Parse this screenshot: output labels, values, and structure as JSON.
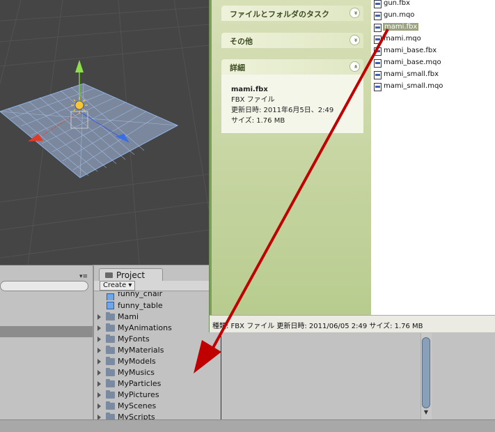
{
  "project_panel": {
    "tab_label": "Project",
    "create_label": "Create",
    "create_caret": "▾",
    "items": [
      {
        "label": "funny_chair",
        "kind": "asset",
        "has_arrow": false
      },
      {
        "label": "funny_table",
        "kind": "asset",
        "has_arrow": false
      },
      {
        "label": "Mami",
        "kind": "folder",
        "has_arrow": true
      },
      {
        "label": "MyAnimations",
        "kind": "folder",
        "has_arrow": true
      },
      {
        "label": "MyFonts",
        "kind": "folder",
        "has_arrow": true
      },
      {
        "label": "MyMaterials",
        "kind": "folder",
        "has_arrow": true
      },
      {
        "label": "MyModels",
        "kind": "folder",
        "has_arrow": true
      },
      {
        "label": "MyMusics",
        "kind": "folder",
        "has_arrow": true
      },
      {
        "label": "MyParticles",
        "kind": "folder",
        "has_arrow": true
      },
      {
        "label": "MyPictures",
        "kind": "folder",
        "has_arrow": true
      },
      {
        "label": "MyScenes",
        "kind": "folder",
        "has_arrow": true
      },
      {
        "label": "MyScripts",
        "kind": "folder",
        "has_arrow": true
      }
    ]
  },
  "hierarchy_panel": {
    "menu_glyph": "▾≡"
  },
  "explorer": {
    "tasks_header": "ファイルとフォルダのタスク",
    "other_header": "その他",
    "details_header": "詳細",
    "chevron_down": "»",
    "chevron_up": "«",
    "details": {
      "file_name": "mami.fbx",
      "file_type": "FBX ファイル",
      "modified": "更新日時: 2011年6月5日、2:49",
      "size": "サイズ: 1.76 MB"
    },
    "files": [
      {
        "name": "gun.fbx",
        "selected": false
      },
      {
        "name": "gun.mqo",
        "selected": false
      },
      {
        "name": "mami.fbx",
        "selected": true
      },
      {
        "name": "mami.mqo",
        "selected": false
      },
      {
        "name": "mami_base.fbx",
        "selected": false
      },
      {
        "name": "mami_base.mqo",
        "selected": false
      },
      {
        "name": "mami_small.fbx",
        "selected": false
      },
      {
        "name": "mami_small.mqo",
        "selected": false
      }
    ],
    "status_bar": "種類: FBX ファイル 更新日時: 2011/06/05 2:49 サイズ: 1.76 MB"
  },
  "scrollbar": {
    "down_glyph": "▼"
  },
  "colors": {
    "annotation_arrow": "#c00000",
    "scene_background": "#454545",
    "explorer_task_pane": "#c5d6a0"
  }
}
